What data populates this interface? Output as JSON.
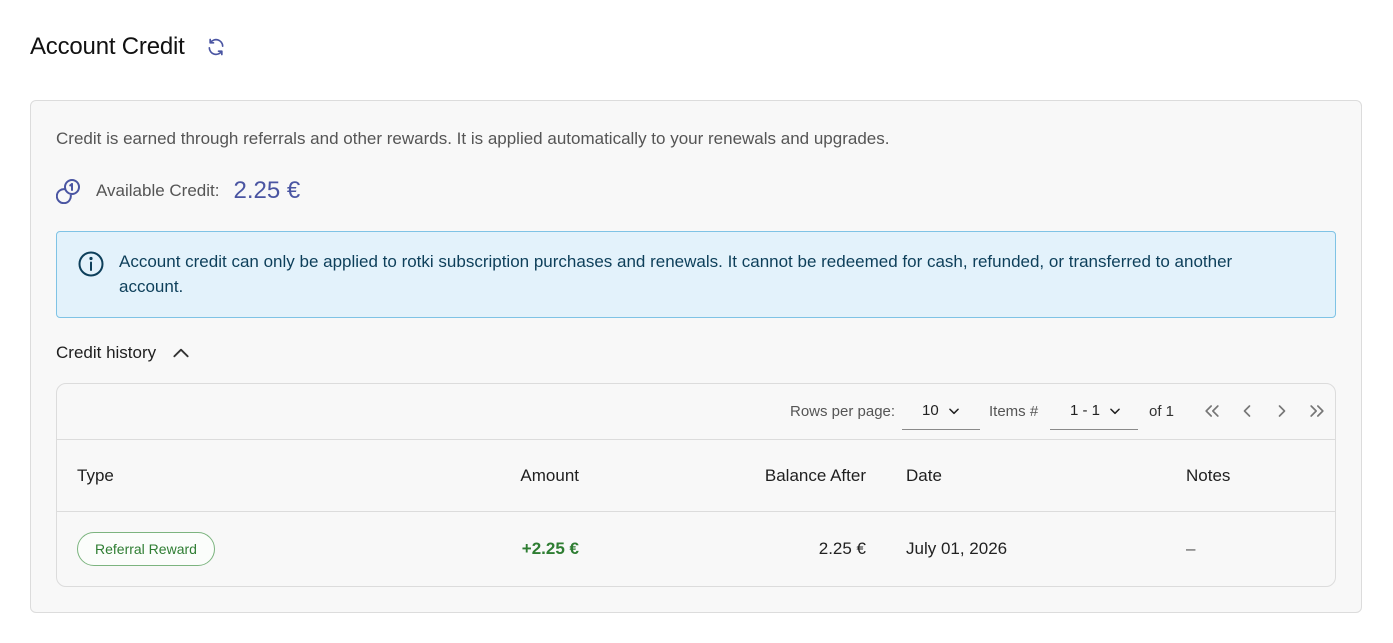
{
  "header": {
    "title": "Account Credit"
  },
  "card": {
    "description": "Credit is earned through referrals and other rewards. It is applied automatically to your renewals and upgrades.",
    "available_label": "Available Credit:",
    "available_value": "2.25 €",
    "alert_text": "Account credit can only be applied to rotki subscription purchases and renewals. It cannot be redeemed for cash, refunded, or transferred to another account.",
    "history_label": "Credit history"
  },
  "pagination": {
    "rows_per_page_label": "Rows per page:",
    "rows_per_page_value": "10",
    "items_label": "Items #",
    "items_range_value": "1 - 1",
    "total_label": "of 1"
  },
  "table": {
    "columns": {
      "type": "Type",
      "amount": "Amount",
      "balance_after": "Balance After",
      "date": "Date",
      "notes": "Notes"
    },
    "rows": [
      {
        "type": "Referral Reward",
        "amount": "+2.25 €",
        "balance_after": "2.25 €",
        "date": "July 01, 2026",
        "notes": "–"
      }
    ]
  },
  "icons": {
    "refresh": "refresh-icon",
    "credit": "coins-icon",
    "info": "info-icon",
    "collapse": "chevron-up-icon",
    "first_page": "chevrons-left-icon",
    "prev_page": "chevron-left-icon",
    "next_page": "chevron-right-icon",
    "last_page": "chevrons-right-icon"
  },
  "colors": {
    "accent": "#4a55a2",
    "positive": "#2e7d32",
    "alert_bg": "#e3f2fb",
    "alert_border": "#7fc3e5",
    "alert_text": "#0d3f5a"
  }
}
